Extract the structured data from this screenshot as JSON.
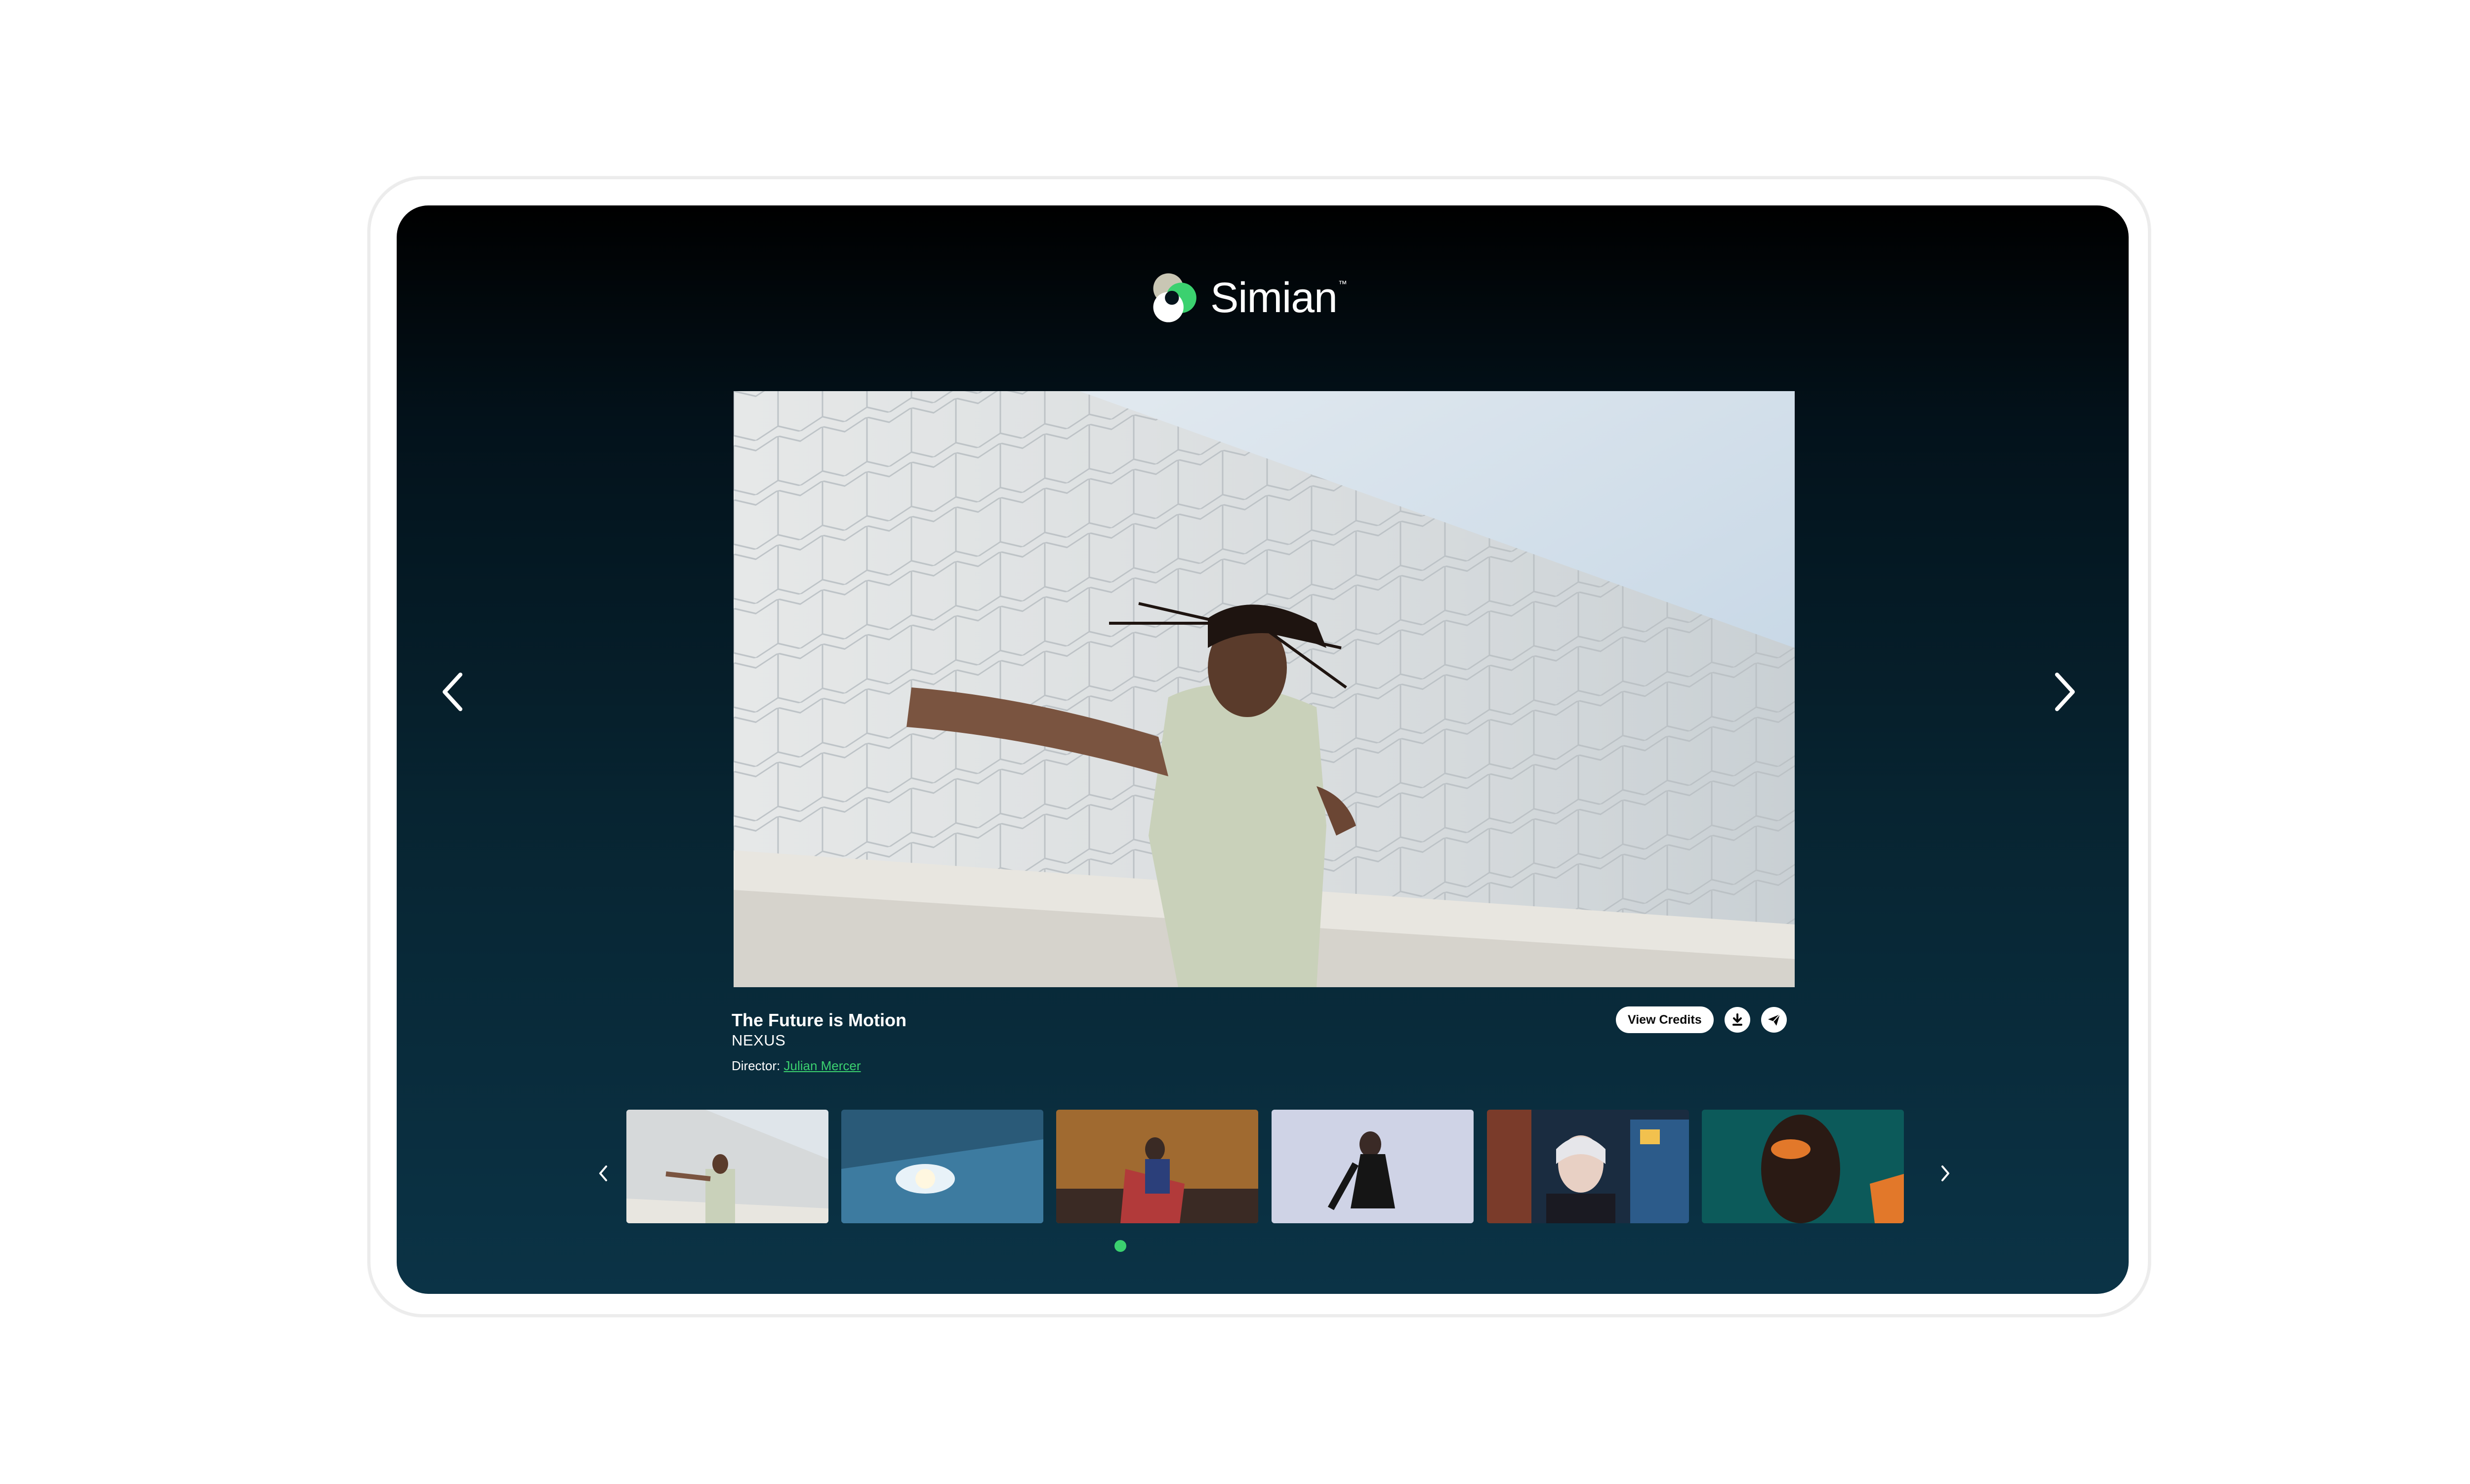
{
  "brand": {
    "name": "Simian",
    "trademark": "™",
    "accent_color": "#3bd16f"
  },
  "player": {
    "prev_icon": "chevron-left-icon",
    "next_icon": "chevron-right-icon"
  },
  "reel": {
    "title": "The Future is Motion",
    "client": "NEXUS",
    "director_label": "Director:",
    "director_name": "Julian Mercer",
    "credits_button": "View Credits",
    "download_icon": "download-icon",
    "share_icon": "send-icon"
  },
  "thumbnails": {
    "items": [
      {
        "subject": "dancer-by-tiled-wall",
        "active": true
      },
      {
        "subject": "car-headlight",
        "active": false
      },
      {
        "subject": "man-with-flag",
        "active": false
      },
      {
        "subject": "blurred-dancer",
        "active": false
      },
      {
        "subject": "woman-city-night",
        "active": false
      },
      {
        "subject": "man-orange-light",
        "active": false
      }
    ],
    "active_index": 0
  }
}
